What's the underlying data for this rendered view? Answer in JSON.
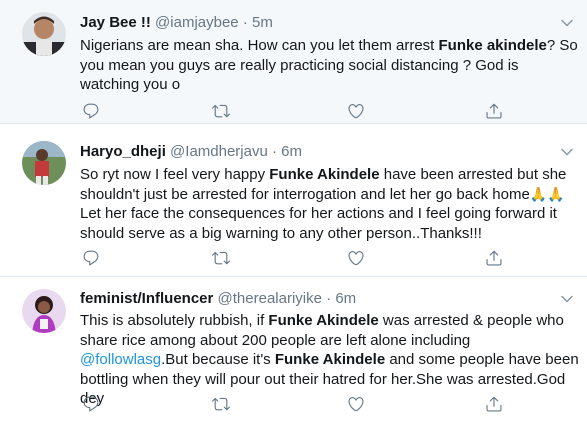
{
  "colors": {
    "highlight_bg": "#f5f8fa",
    "text": "#14171a",
    "muted": "#657786",
    "link": "#1b95e0",
    "divider": "#e1e8ed"
  },
  "tweets": [
    {
      "name": "Jay Bee !!",
      "handle": "@iamjaybee",
      "dot": "·",
      "time": "5m",
      "text": {
        "p1": "Nigerians are mean sha.  How can you let them arrest ",
        "b1": "Funke akindele",
        "p2": "? So you mean you guys are really practicing social distancing ? God is watching you o"
      },
      "actions": [
        "reply-icon",
        "retweet-icon",
        "like-icon",
        "share-icon"
      ]
    },
    {
      "name": "Haryo_dheji",
      "handle": "@Iamdherjavu",
      "dot": "·",
      "time": "6m",
      "text": {
        "p1": "So ryt now I feel very happy ",
        "b1": "Funke Akindele",
        "p2": " have been arrested but she shouldn't just be arrested for interrogation and let her go back home",
        "emoji": "🙏🙏",
        "p3": "  Let her face the consequences for her actions and I feel going forward it should serve as a big warning to any other person..Thanks!!!"
      },
      "actions": [
        "reply-icon",
        "retweet-icon",
        "like-icon",
        "share-icon"
      ]
    },
    {
      "name": "feminist/Influencer",
      "handle": "@therealariyike",
      "dot": "·",
      "time": "6m",
      "text": {
        "p1": "This is absolutely rubbish, if ",
        "b1": "Funke Akindele",
        "p2": " was arrested & people who share rice among about 200 people are left alone including ",
        "link": "@followlasg",
        "p3": ".But because it's ",
        "b2": "Funke Akindele",
        "p4": " and some people have been bottling when they will pour out their hatred for her.She was arrested.God dey"
      },
      "actions": [
        "reply-icon",
        "retweet-icon",
        "like-icon",
        "share-icon"
      ]
    }
  ]
}
